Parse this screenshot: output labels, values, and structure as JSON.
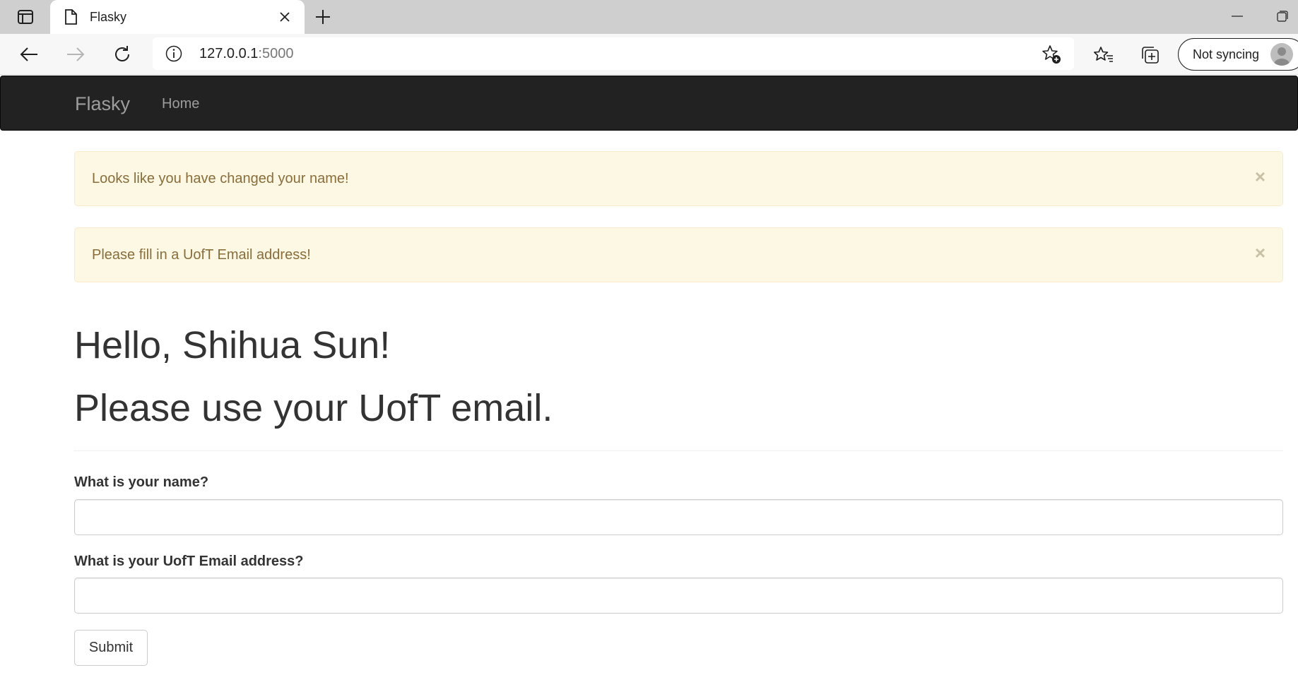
{
  "browser": {
    "tab_title": "Flasky",
    "url_host": "127.0.0.1",
    "url_port": ":5000",
    "sync_label": "Not syncing",
    "icons": [
      "tab-actions-icon",
      "page-icon",
      "close-icon",
      "plus-icon",
      "minimize-icon",
      "restore-icon",
      "back-arrow-icon",
      "forward-arrow-icon",
      "refresh-icon",
      "info-icon",
      "add-favorite-icon",
      "favorites-icon",
      "collections-icon",
      "profile-avatar-icon"
    ]
  },
  "navbar": {
    "brand": "Flasky",
    "links": [
      {
        "label": "Home"
      }
    ],
    "background": "#222222"
  },
  "alerts": [
    {
      "text": "Looks like you have changed your name!",
      "close": "×"
    },
    {
      "text": "Please fill in a UofT Email address!",
      "close": "×"
    }
  ],
  "page": {
    "greeting": "Hello, Shihua Sun!",
    "message": "Please use your UofT email."
  },
  "form": {
    "name_label": "What is your name?",
    "name_value": "",
    "email_label": "What is your UofT Email address?",
    "email_value": "",
    "submit_label": "Submit"
  },
  "colors": {
    "alert_bg": "#fcf8e3",
    "alert_text": "#8a6d3b",
    "navbar_text": "#9d9d9d"
  }
}
